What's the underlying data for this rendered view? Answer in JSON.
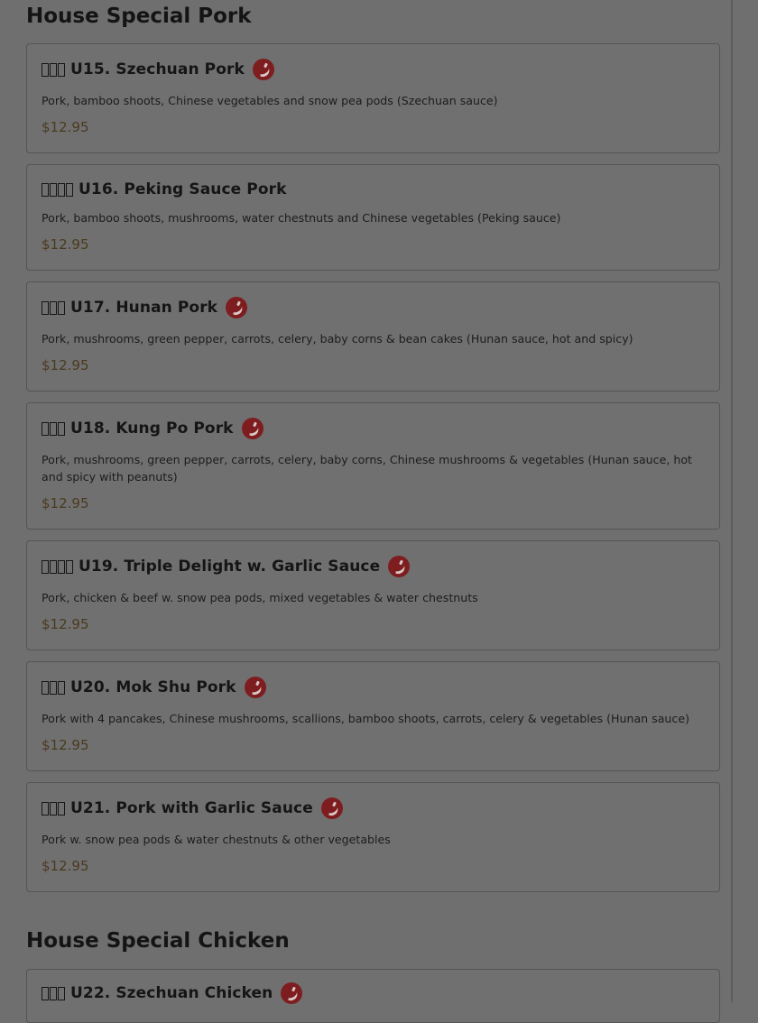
{
  "sections": [
    {
      "title": "House Special Pork",
      "items": [
        {
          "name": "U15. Szechuan Pork",
          "cjk_count": 3,
          "spicy": true,
          "description": "Pork, bamboo shoots, Chinese vegetables and snow pea pods (Szechuan sauce)",
          "price": "$12.95"
        },
        {
          "name": "U16. Peking Sauce Pork",
          "cjk_count": 4,
          "spicy": false,
          "description": "Pork, bamboo shoots, mushrooms, water chestnuts and Chinese vegetables (Peking sauce)",
          "price": "$12.95"
        },
        {
          "name": "U17. Hunan Pork",
          "cjk_count": 3,
          "spicy": true,
          "description": "Pork, mushrooms, green pepper, carrots, celery, baby corns & bean cakes (Hunan sauce, hot and spicy)",
          "price": "$12.95"
        },
        {
          "name": "U18. Kung Po Pork",
          "cjk_count": 3,
          "spicy": true,
          "description": "Pork, mushrooms, green pepper, carrots, celery, baby corns, Chinese mushrooms & vegetables (Hunan sauce, hot and spicy with peanuts)",
          "price": "$12.95"
        },
        {
          "name": "U19. Triple Delight w. Garlic Sauce",
          "cjk_count": 4,
          "spicy": true,
          "description": "Pork, chicken & beef w. snow pea pods, mixed vegetables & water chestnuts",
          "price": "$12.95"
        },
        {
          "name": "U20. Mok Shu Pork",
          "cjk_count": 3,
          "spicy": true,
          "description": "Pork with 4 pancakes, Chinese mushrooms, scallions, bamboo shoots, carrots, celery & vegetables (Hunan sauce)",
          "price": "$12.95"
        },
        {
          "name": "U21. Pork with Garlic Sauce",
          "cjk_count": 3,
          "spicy": true,
          "description": "Pork w. snow pea pods & water chestnuts & other vegetables",
          "price": "$12.95"
        }
      ]
    },
    {
      "title": "House Special Chicken",
      "items": [
        {
          "name": "U22. Szechuan Chicken",
          "cjk_count": 3,
          "spicy": true
        }
      ]
    }
  ],
  "icons": {
    "spicy": "chili-pepper-icon"
  },
  "colors": {
    "overlay": "#6f6f6f",
    "spicy_badge": "#7e1d1f",
    "price": "#4b3a20"
  }
}
